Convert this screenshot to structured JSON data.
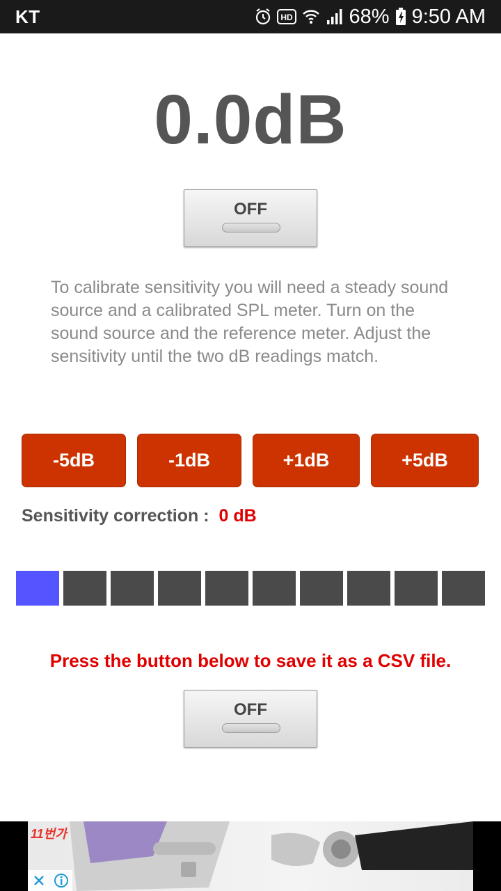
{
  "status_bar": {
    "carrier": "KT",
    "battery": "68%",
    "time": "9:50 AM",
    "icons": [
      "alarm-icon",
      "hd-icon",
      "wifi-icon",
      "signal-icon",
      "battery-icon"
    ]
  },
  "meter": {
    "reading": "0.0dB"
  },
  "toggle_top": {
    "label": "OFF"
  },
  "instructions": "To calibrate sensitivity you will need a steady sound source and a calibrated SPL meter. Turn on the sound source and the reference meter. Adjust the sensitivity until the two dB readings match.",
  "adjust_buttons": [
    {
      "label": "-5dB"
    },
    {
      "label": "-1dB"
    },
    {
      "label": "+1dB"
    },
    {
      "label": "+5dB"
    }
  ],
  "correction": {
    "label": "Sensitivity correction :",
    "value": "0 dB"
  },
  "level_bar": {
    "segments": 10,
    "active_segments": 1,
    "active_color": "#5555ff",
    "inactive_color": "#4a4a4a"
  },
  "csv_note": "Press the button below to save it as a CSV file.",
  "toggle_bottom": {
    "label": "OFF"
  },
  "ad": {
    "logo_text": "11번가",
    "icons": [
      "close-icon",
      "info-icon"
    ]
  },
  "colors": {
    "accent_button": "#cc3300",
    "alert_text": "#e00000",
    "reading_text": "#555555"
  }
}
